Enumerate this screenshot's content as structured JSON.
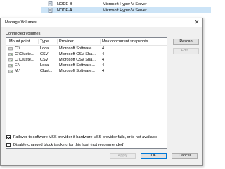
{
  "background_list": [
    {
      "name": "NODE-B",
      "type": "Microsoft Hyper-V Server",
      "selected": false
    },
    {
      "name": "NODE-A",
      "type": "Microsoft Hyper-V Server",
      "selected": true
    }
  ],
  "dialog": {
    "title": "Manage Volumes",
    "close_glyph": "✕",
    "group_label": "Connected volumes:",
    "columns": [
      "Mount point",
      "Type",
      "Provider",
      "Max concurrent snapshots"
    ],
    "rows": [
      {
        "mount": "C:\\",
        "type": "Local",
        "provider": "Microsoft Software...",
        "snapshots": "4"
      },
      {
        "mount": "C:\\Cluste...",
        "type": "CSV",
        "provider": "Microsoft CSV Sha...",
        "snapshots": "4"
      },
      {
        "mount": "C:\\Cluste...",
        "type": "CSV",
        "provider": "Microsoft CSV Sha...",
        "snapshots": "4"
      },
      {
        "mount": "E:\\",
        "type": "Local",
        "provider": "Microsoft Software...",
        "snapshots": "4"
      },
      {
        "mount": "M:\\",
        "type": "Clust...",
        "provider": "Microsoft Software...",
        "snapshots": "4"
      }
    ],
    "buttons": {
      "rescan": "Rescan",
      "edit": "Edit...",
      "apply": "Apply",
      "ok": "OK",
      "cancel": "Cancel"
    },
    "options": {
      "failover_label": "Failover to software VSS provider if hardware VSS provider fails, or is not available",
      "failover_checked": true,
      "disable_cbt_label": "Disable changed block tracking for this host (not recommended)",
      "disable_cbt_checked": false
    }
  },
  "colors": {
    "selection": "#cce4f7",
    "accent": "#0078d7"
  }
}
